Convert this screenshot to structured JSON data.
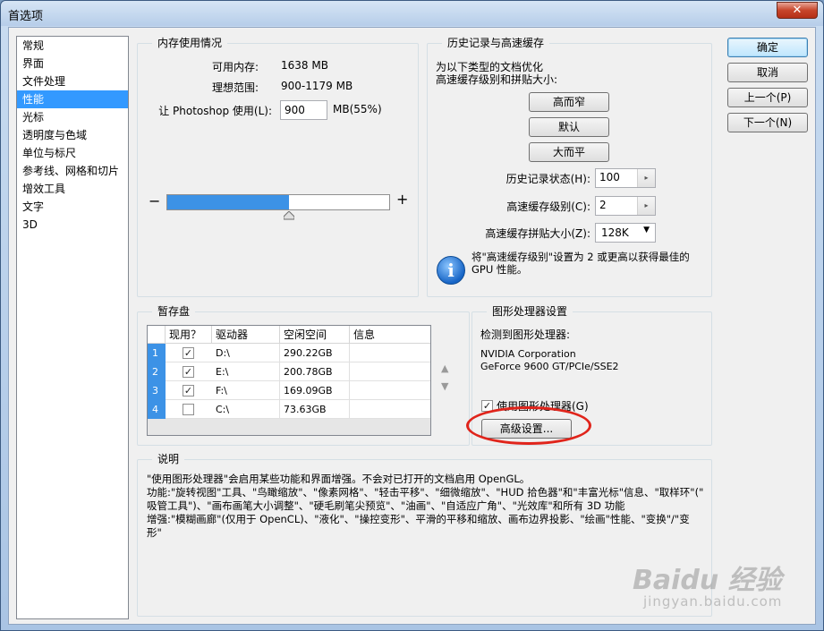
{
  "window": {
    "title": "首选项",
    "close_glyph": "✕"
  },
  "nav": {
    "items": [
      {
        "label": "常规"
      },
      {
        "label": "界面"
      },
      {
        "label": "文件处理"
      },
      {
        "label": "性能",
        "selected": true
      },
      {
        "label": "光标"
      },
      {
        "label": "透明度与色域"
      },
      {
        "label": "单位与标尺"
      },
      {
        "label": "参考线、网格和切片"
      },
      {
        "label": "增效工具"
      },
      {
        "label": "文字"
      },
      {
        "label": "3D"
      }
    ]
  },
  "memory": {
    "title": "内存使用情况",
    "available_label": "可用内存:",
    "available_value": "1638 MB",
    "ideal_label": "理想范围:",
    "ideal_value": "900-1179 MB",
    "use_label": "让 Photoshop 使用(L):",
    "use_value": "900",
    "use_unit": "MB(55%)",
    "minus": "−",
    "plus": "+",
    "slider_fraction": 0.55
  },
  "history": {
    "title": "历史记录与高速缓存",
    "optimize_line1": "为以下类型的文档优化",
    "optimize_line2": "高速缓存级别和拼贴大小:",
    "btn_tall_thin": "高而窄",
    "btn_default": "默认",
    "btn_big_flat": "大而平",
    "states_label": "历史记录状态(H):",
    "states_value": "100",
    "cache_levels_label": "高速缓存级别(C):",
    "cache_levels_value": "2",
    "tile_size_label": "高速缓存拼贴大小(Z):",
    "tile_size_value": "128K",
    "tip_line1": "将\"高速缓存级别\"设置为 2 或更高以获得最佳的",
    "tip_line2": "GPU 性能。",
    "info_glyph": "i"
  },
  "scratch": {
    "title": "暂存盘",
    "columns": [
      "现用？",
      "驱动器",
      "空闲空间",
      "信息"
    ],
    "rows": [
      {
        "n": "1",
        "active": true,
        "drive": "D:\\",
        "free": "290.22GB",
        "info": ""
      },
      {
        "n": "2",
        "active": true,
        "drive": "E:\\",
        "free": "200.78GB",
        "info": ""
      },
      {
        "n": "3",
        "active": true,
        "drive": "F:\\",
        "free": "169.09GB",
        "info": ""
      },
      {
        "n": "4",
        "active": false,
        "drive": "C:\\",
        "free": "73.63GB",
        "info": ""
      }
    ],
    "up_glyph": "▲",
    "down_glyph": "▼"
  },
  "gpu": {
    "title": "图形处理器设置",
    "detected_label": "检测到图形处理器:",
    "vendor": "NVIDIA Corporation",
    "model": "GeForce 9600 GT/PCIe/SSE2",
    "use_gpu_label": "使用图形处理器(G)",
    "use_gpu_checked": true,
    "advanced_button": "高级设置..."
  },
  "description": {
    "title": "说明",
    "lines": [
      "\"使用图形处理器\"会启用某些功能和界面增强。不会对已打开的文档启用 OpenGL。",
      "功能:\"旋转视图\"工具、\"鸟瞰缩放\"、\"像素网格\"、\"轻击平移\"、\"细微缩放\"、\"HUD 拾色器\"和\"丰富光标\"信息、\"取样环\"(\"",
      "吸管工具\")、\"画布画笔大小调整\"、\"硬毛刷笔尖预览\"、\"油画\"、\"自适应广角\"、\"光效库\"和所有 3D 功能",
      "增强:\"模糊画廊\"(仅用于 OpenCL)、\"液化\"、\"操控变形\"、平滑的平移和缩放、画布边界投影、\"绘画\"性能、\"变换\"/\"变",
      "形\""
    ]
  },
  "buttons": {
    "ok": "确定",
    "cancel": "取消",
    "prev": "上一个(P)",
    "next": "下一个(N)"
  },
  "watermark": {
    "brand": "Baidu 经验",
    "url": "jingyan.baidu.com"
  },
  "colors": {
    "selection": "#3399ff",
    "slider_fill": "#3c92e6",
    "annotation": "#e0241b"
  }
}
